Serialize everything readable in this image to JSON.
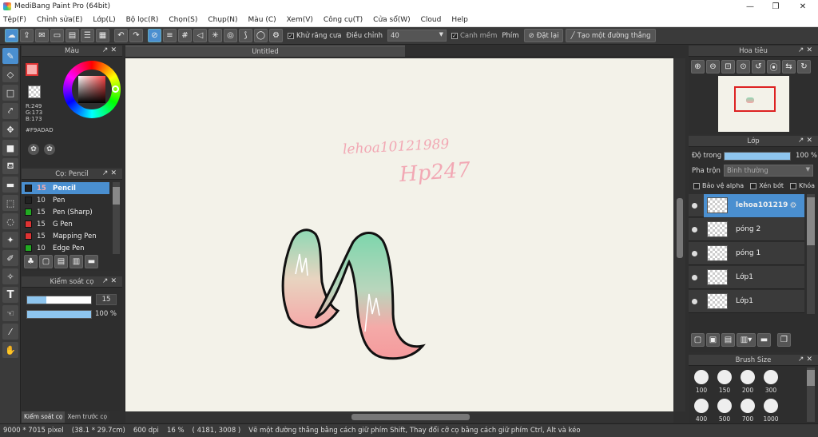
{
  "window": {
    "title": "MediBang Paint Pro (64bit)",
    "minimize": "—",
    "maximize": "❐",
    "close": "✕"
  },
  "menu": [
    "Tệp(F)",
    "Chỉnh sửa(E)",
    "Lớp(L)",
    "Bộ lọc(R)",
    "Chọn(S)",
    "Chụp(N)",
    "Màu (C)",
    "Xem(V)",
    "Công cụ(T)",
    "Cửa sổ(W)",
    "Cloud",
    "Help"
  ],
  "toolbar": {
    "antialias_label": "Khử răng cưa",
    "adjust_label": "Điều chỉnh",
    "adjust_value": "40",
    "snap_label": "Canh mềm",
    "key_label": "Phím",
    "reset_label": "Đặt lại",
    "straight_label": "Tạo một đường thẳng"
  },
  "color_panel": {
    "title": "Màu",
    "r": "R:249",
    "g": "G:173",
    "b": "B:173",
    "hex": "#F9ADAD",
    "primary": "#F9ADAD"
  },
  "brush_panel": {
    "title": "Cọ: Pencil",
    "brushes": [
      {
        "size": "15",
        "name": "Pencil",
        "color": "#222222"
      },
      {
        "size": "10",
        "name": "Pen",
        "color": "#222222"
      },
      {
        "size": "15",
        "name": "Pen (Sharp)",
        "color": "#22aa22"
      },
      {
        "size": "15",
        "name": "G Pen",
        "color": "#dd3333"
      },
      {
        "size": "15",
        "name": "Mapping Pen",
        "color": "#dd3333"
      },
      {
        "size": "10",
        "name": "Edge Pen",
        "color": "#22aa22"
      }
    ]
  },
  "brush_control": {
    "title": "Kiểm soát cọ",
    "size": "15",
    "size_fraction": 0.3,
    "opacity": "100 %",
    "opacity_fraction": 1.0
  },
  "left_tabs": {
    "tab1": "Kiểm soát cọ",
    "tab2": "Xem trước cọ"
  },
  "document": {
    "tab": "Untitled"
  },
  "canvas_text": {
    "sig1": "lehoa10121989",
    "sig2": "Hp247"
  },
  "navigator": {
    "title": "Hoa tiêu"
  },
  "layers": {
    "title": "Lớp",
    "opacity_label": "Độ trong",
    "opacity_value": "100 %",
    "blend_label": "Pha trộn",
    "blend_value": "Bình thường",
    "protect_alpha": "Bảo vệ alpha",
    "clip": "Xén bớt",
    "lock": "Khóa",
    "items": [
      "lehoa101219",
      "póng 2",
      "póng 1",
      "Lớp1",
      "Lớp1"
    ]
  },
  "brush_size": {
    "title": "Brush Size",
    "sizes": [
      "100",
      "150",
      "200",
      "300",
      "400",
      "500",
      "700",
      "1000"
    ]
  },
  "status": {
    "dims": "9000 * 7015 pixel",
    "cm": "(38.1 * 29.7cm)",
    "dpi": "600 dpi",
    "zoom": "16 %",
    "coords": "( 4181, 3008 )",
    "hint": "Vẽ một đường thẳng bằng cách giữ phím Shift, Thay đổi cỡ cọ bằng cách giữ phím Ctrl, Alt và kéo"
  }
}
